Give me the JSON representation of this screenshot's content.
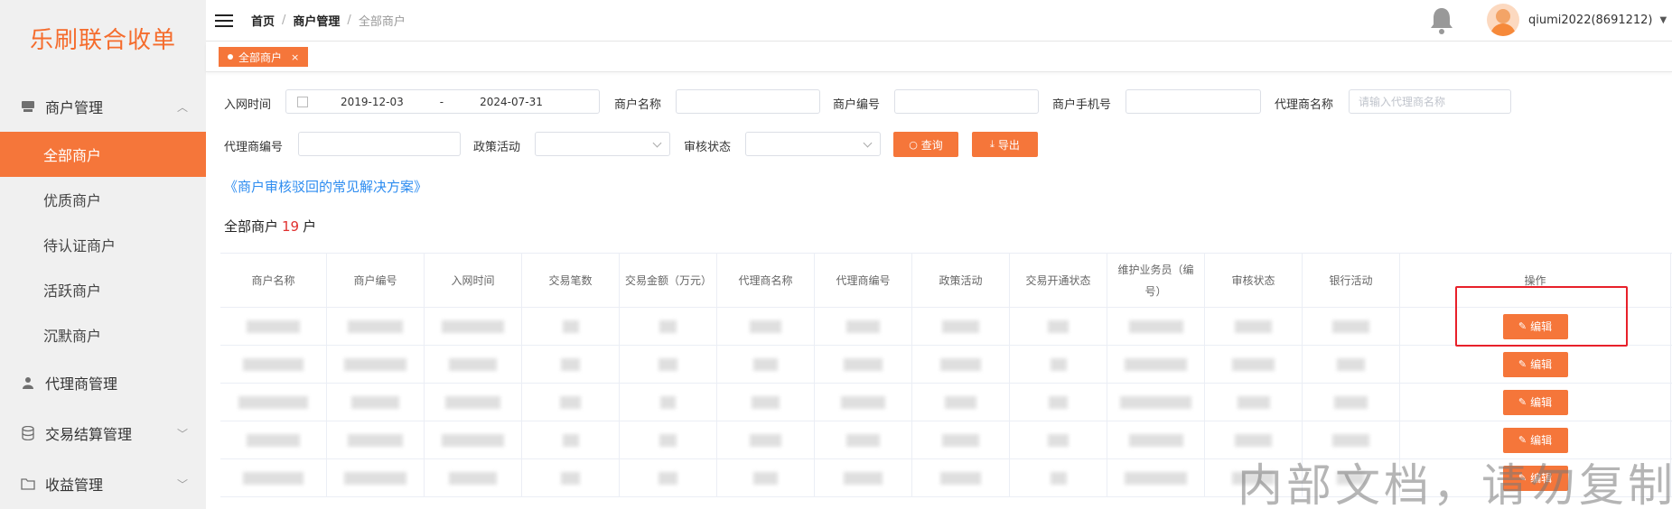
{
  "app": {
    "logo": "乐刷联合收单"
  },
  "sidebar": {
    "groups": [
      {
        "label": "商户管理",
        "icon": "storefront-icon",
        "expanded": true,
        "items": [
          {
            "label": "全部商户",
            "active": true
          },
          {
            "label": "优质商户"
          },
          {
            "label": "待认证商户"
          },
          {
            "label": "活跃商户"
          },
          {
            "label": "沉默商户"
          }
        ]
      },
      {
        "label": "代理商管理",
        "icon": "user-icon"
      },
      {
        "label": "交易结算管理",
        "icon": "database-icon"
      },
      {
        "label": "收益管理",
        "icon": "folder-icon"
      }
    ]
  },
  "header": {
    "breadcrumb": [
      "首页",
      "商户管理",
      "全部商户"
    ],
    "user": "qiumi2022(8691212)"
  },
  "tabs": [
    {
      "label": "全部商户",
      "close": "×"
    }
  ],
  "filters": {
    "join_time_label": "入网时间",
    "date_start": "2019-12-03",
    "date_sep": "-",
    "date_end": "2024-07-31",
    "merchant_name_label": "商户名称",
    "merchant_no_label": "商户编号",
    "merchant_phone_label": "商户手机号",
    "agent_name_label": "代理商名称",
    "agent_name_placeholder": "请输入代理商名称",
    "agent_no_label": "代理商编号",
    "policy_label": "政策活动",
    "audit_label": "审核状态",
    "search_button": "查询",
    "export_button": "导出"
  },
  "main": {
    "help_link": "《商户审核驳回的常见解决方案》",
    "count_prefix": "全部商户",
    "count_value": "19",
    "count_suffix": "户"
  },
  "table": {
    "columns": [
      "商户名称",
      "商户编号",
      "入网时间",
      "交易笔数",
      "交易金额（万元）",
      "代理商名称",
      "代理商编号",
      "政策活动",
      "交易开通状态",
      "维护业务员（编号）",
      "审核状态",
      "银行活动",
      "操作"
    ],
    "row_action": "编辑",
    "row_count": 5
  },
  "watermark": "内部文档，请勿复制",
  "colors": {
    "brand": "#f5763a",
    "link": "#2d8cf0",
    "count": "#e0302f",
    "highlight": "#e8202a"
  }
}
